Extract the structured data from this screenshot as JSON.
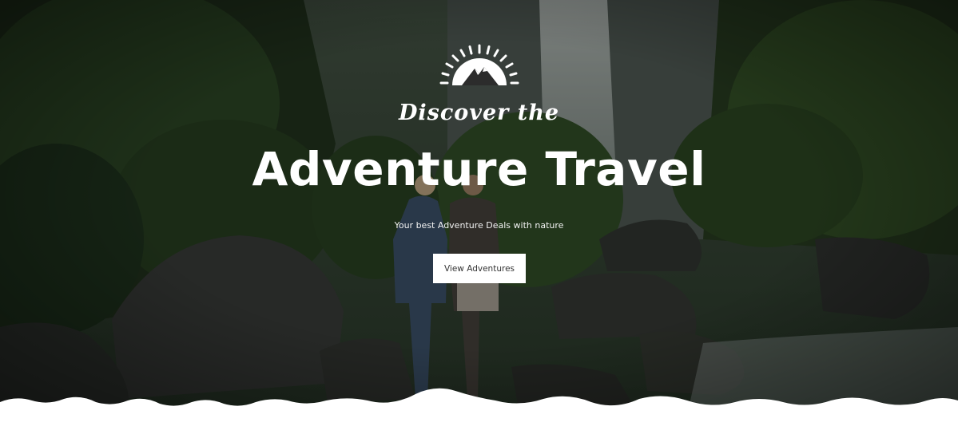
{
  "hero": {
    "eyebrow": "Discover the",
    "headline": "Adventure Travel",
    "tagline": "Your best Adventure Deals with nature",
    "cta_label": "View Adventures",
    "logo_icon": "sunrise-mountain-icon",
    "background_image": "jungle-waterfall-hikers-photo"
  },
  "colors": {
    "text": "#ffffff",
    "button_bg": "#ffffff",
    "button_text": "#333333",
    "divider": "#ffffff"
  }
}
